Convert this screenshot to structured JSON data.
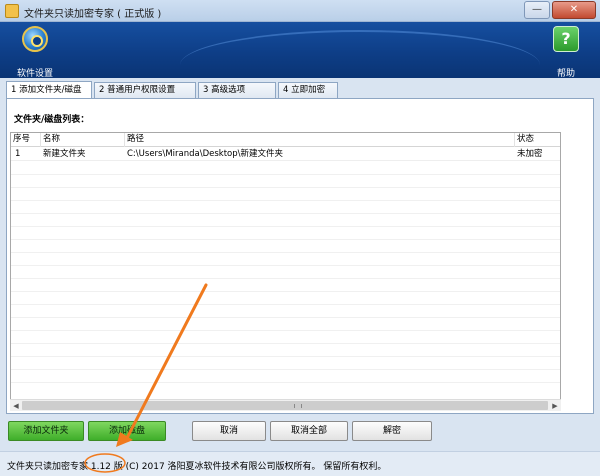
{
  "window": {
    "title": "文件夹只读加密专家 ( 正式版 )",
    "minimize_glyph": "—",
    "close_glyph": "✕"
  },
  "toolbar": {
    "settings_label": "软件设置",
    "help_label": "帮助",
    "help_glyph": "?"
  },
  "tabs": [
    {
      "label": "1 添加文件夹/磁盘",
      "active": true
    },
    {
      "label": "2 普通用户权限设置",
      "active": false
    },
    {
      "label": "3 高级选项",
      "active": false
    },
    {
      "label": "4 立即加密",
      "active": false
    }
  ],
  "main": {
    "section_label": "文件夹/磁盘列表：",
    "columns": [
      "序号",
      "名称",
      "路径",
      "状态"
    ],
    "rows": [
      {
        "index": "1",
        "name": "新建文件夹",
        "path": "C:\\Users\\Miranda\\Desktop\\新建文件夹",
        "status": "未加密"
      }
    ]
  },
  "buttons": {
    "add_folder": "添加文件夹",
    "add_disk": "添加磁盘",
    "cancel": "取消",
    "cancel_all": "取消全部",
    "decrypt": "解密"
  },
  "status": {
    "text": "文件夹只读加密专家 1.12 版 (C) 2017 洛阳夏冰软件技术有限公司版权所有。 保留所有权利。"
  },
  "colors": {
    "accent_blue": "#0e3e87",
    "button_green": "#3fae2a",
    "annotation_orange": "#f07a1e"
  }
}
